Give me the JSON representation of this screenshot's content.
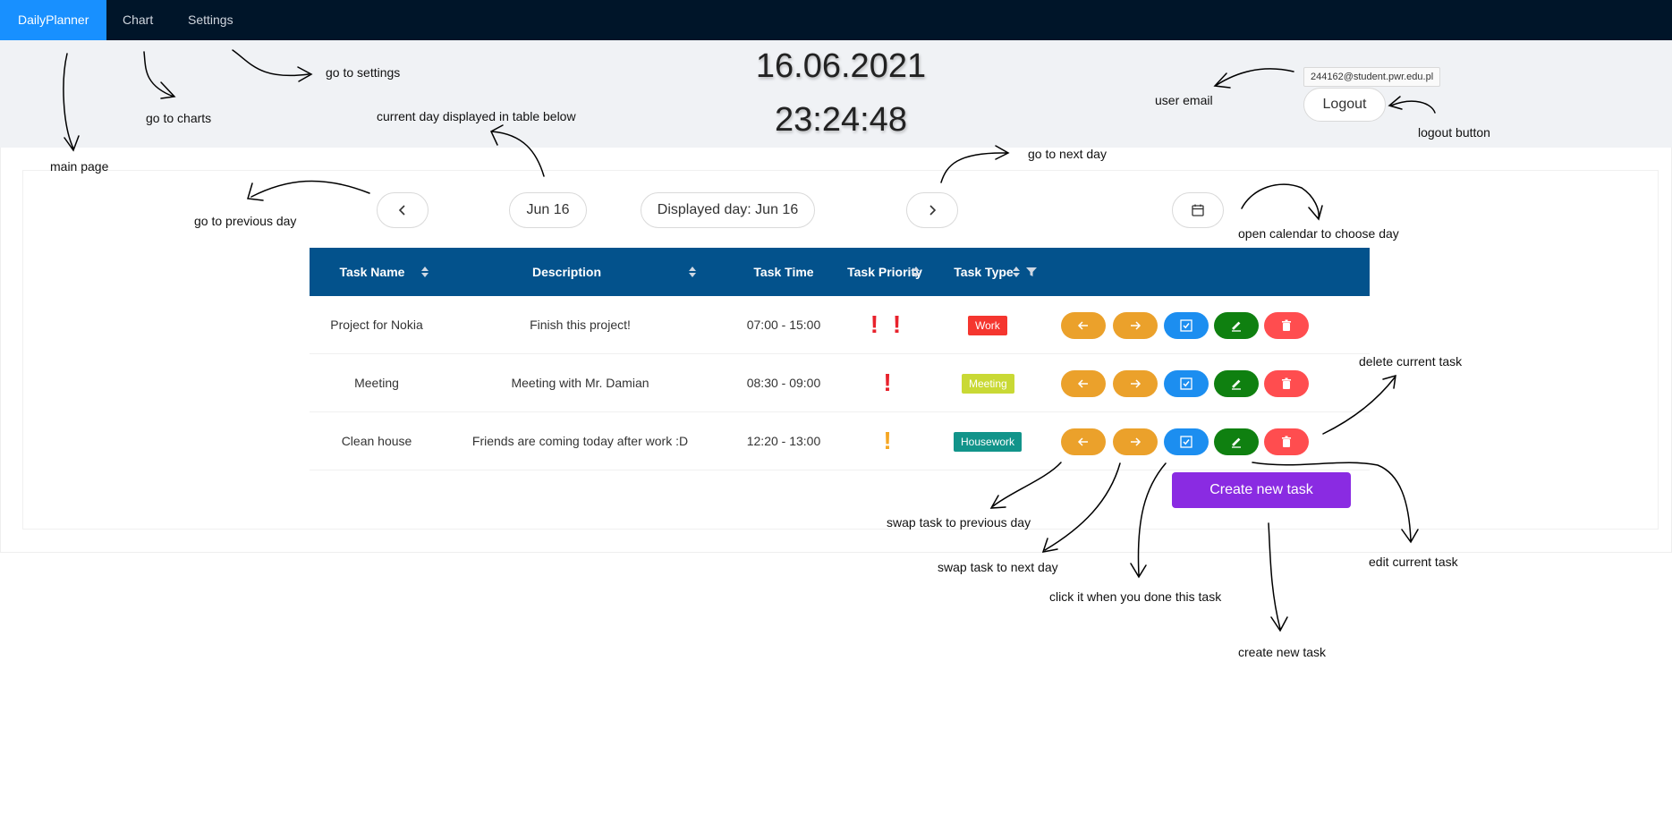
{
  "nav": {
    "brand": "DailyPlanner",
    "chart": "Chart",
    "settings": "Settings"
  },
  "header": {
    "date": "16.06.2021",
    "time": "23:24:48",
    "user_email": "244162@student.pwr.edu.pl",
    "logout_label": "Logout"
  },
  "day_nav": {
    "current_day": "Jun 16",
    "displayed_day": "Displayed day: Jun 16"
  },
  "table": {
    "columns": [
      "Task Name",
      "Description",
      "Task Time",
      "Task Priority",
      "Task Type"
    ],
    "rows": [
      {
        "name": "Project for Nokia",
        "description": "Finish this project!",
        "time": "07:00 - 15:00",
        "priority": "! !",
        "priority_color": "#e8222c",
        "type": "Work",
        "type_color": "#f5362f"
      },
      {
        "name": "Meeting",
        "description": "Meeting with Mr. Damian",
        "time": "08:30 - 09:00",
        "priority": "!",
        "priority_color": "#e8222c",
        "type": "Meeting",
        "type_color": "#c9d935"
      },
      {
        "name": "Clean house",
        "description": "Friends are coming today after work :D",
        "time": "12:20 - 13:00",
        "priority": "!",
        "priority_color": "#f5a623",
        "type": "Housework",
        "type_color": "#12948a"
      }
    ]
  },
  "create_label": "Create new task",
  "annotations": {
    "main_page": "main page",
    "go_to_charts": "go to charts",
    "go_to_settings": "go to settings",
    "current_day": "current day displayed in table below",
    "go_to_previous_day": "go to previous day",
    "go_to_next_day": "go to next day",
    "user_email": "user email",
    "logout_button": "logout button",
    "open_calendar": "open calendar to choose day",
    "delete_task": "delete current task",
    "swap_previous": "swap task to previous day",
    "swap_next": "swap task to next day",
    "done_task": "click it when you done this task",
    "edit_task": "edit current task",
    "create_task": "create new task"
  },
  "colors": {
    "nav_bg": "#001529",
    "active": "#1890ff",
    "table_header": "#03528c",
    "create": "#8a2be2"
  }
}
